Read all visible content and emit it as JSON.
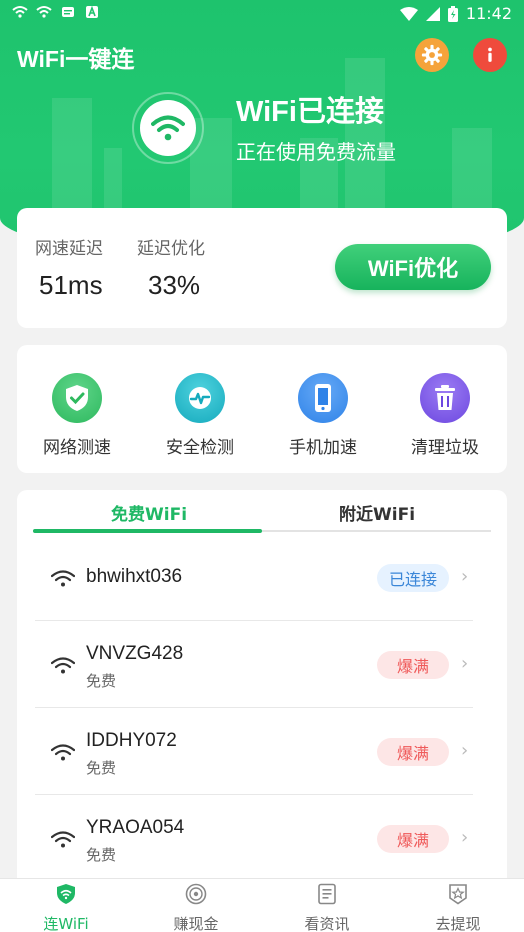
{
  "status_bar": {
    "time": "11:42"
  },
  "header": {
    "title": "WiFi一键连"
  },
  "hero": {
    "title": "WiFi已连接",
    "subtitle": "正在使用免费流量"
  },
  "stats": {
    "latency_label": "网速延迟",
    "latency_value": "51ms",
    "optimize_label": "延迟优化",
    "optimize_value": "33%",
    "optimize_button": "WiFi优化"
  },
  "tools": [
    {
      "label": "网络测速",
      "icon": "shield-check-icon",
      "color": "#3cbf6a"
    },
    {
      "label": "安全检测",
      "icon": "monitor-icon",
      "color": "#23b6c8"
    },
    {
      "label": "手机加速",
      "icon": "phone-icon",
      "color": "#3a8ff0"
    },
    {
      "label": "清理垃圾",
      "icon": "trash-icon",
      "color": "#7b58e8"
    }
  ],
  "tabs": {
    "active": "免费WiFi",
    "inactive": "附近WiFi"
  },
  "wifi_list": [
    {
      "ssid": "bhwihxt036",
      "sub": "",
      "badge": "已连接"
    },
    {
      "ssid": "VNVZG428",
      "sub": "免费",
      "badge": "爆满"
    },
    {
      "ssid": "IDDHY072",
      "sub": "免费",
      "badge": "爆满"
    },
    {
      "ssid": "YRAOA054",
      "sub": "免费",
      "badge": "爆满"
    }
  ],
  "bottom_nav": [
    {
      "label": "连WiFi"
    },
    {
      "label": "赚现金"
    },
    {
      "label": "看资讯"
    },
    {
      "label": "去提现"
    }
  ],
  "colors": {
    "primary": "#1fb865",
    "connected": "#3a86d8",
    "full": "#ef5a5a"
  }
}
